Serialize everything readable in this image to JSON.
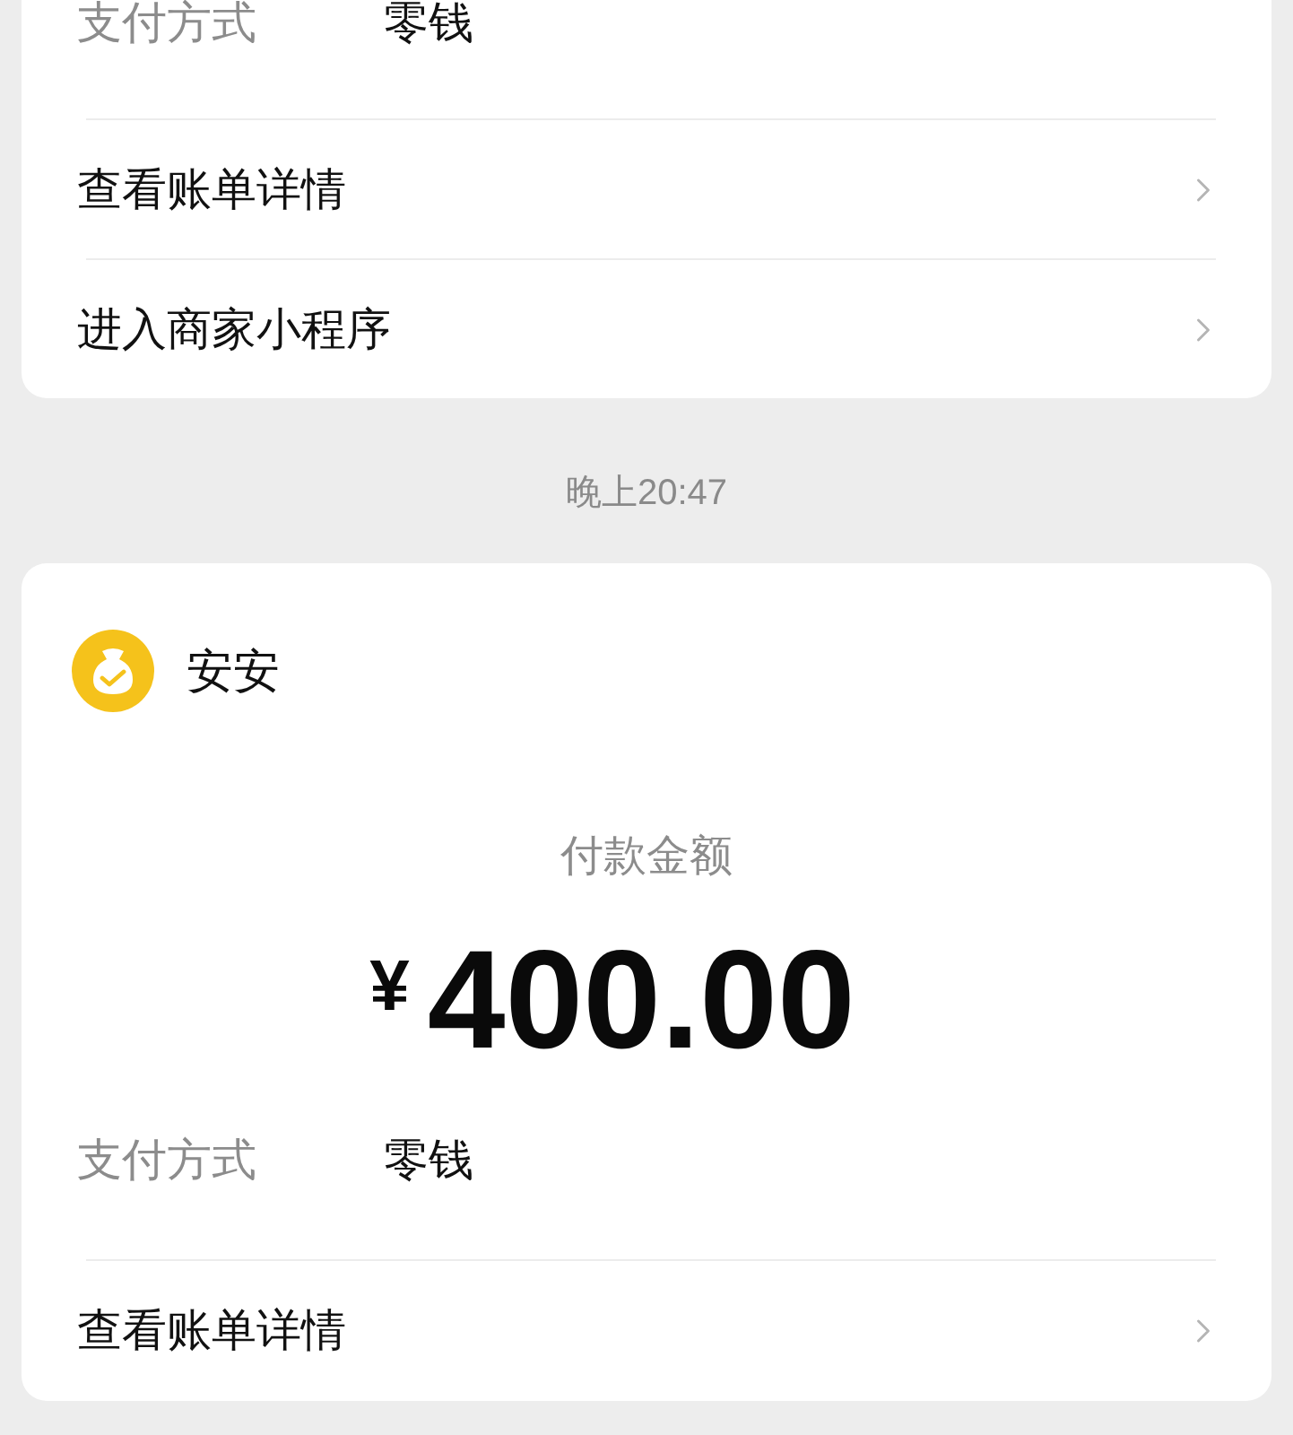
{
  "earlier_record": {
    "payment_method": {
      "label": "支付方式",
      "value": "零钱"
    },
    "links": [
      {
        "label": "查看账单详情"
      },
      {
        "label": "进入商家小程序"
      }
    ]
  },
  "timestamp": "晚上20:47",
  "payment_card": {
    "merchant": "安安",
    "amount_label": "付款金额",
    "currency": "¥",
    "amount": "400.00",
    "payment_method": {
      "label": "支付方式",
      "value": "零钱"
    },
    "links": [
      {
        "label": "查看账单详情"
      }
    ]
  }
}
